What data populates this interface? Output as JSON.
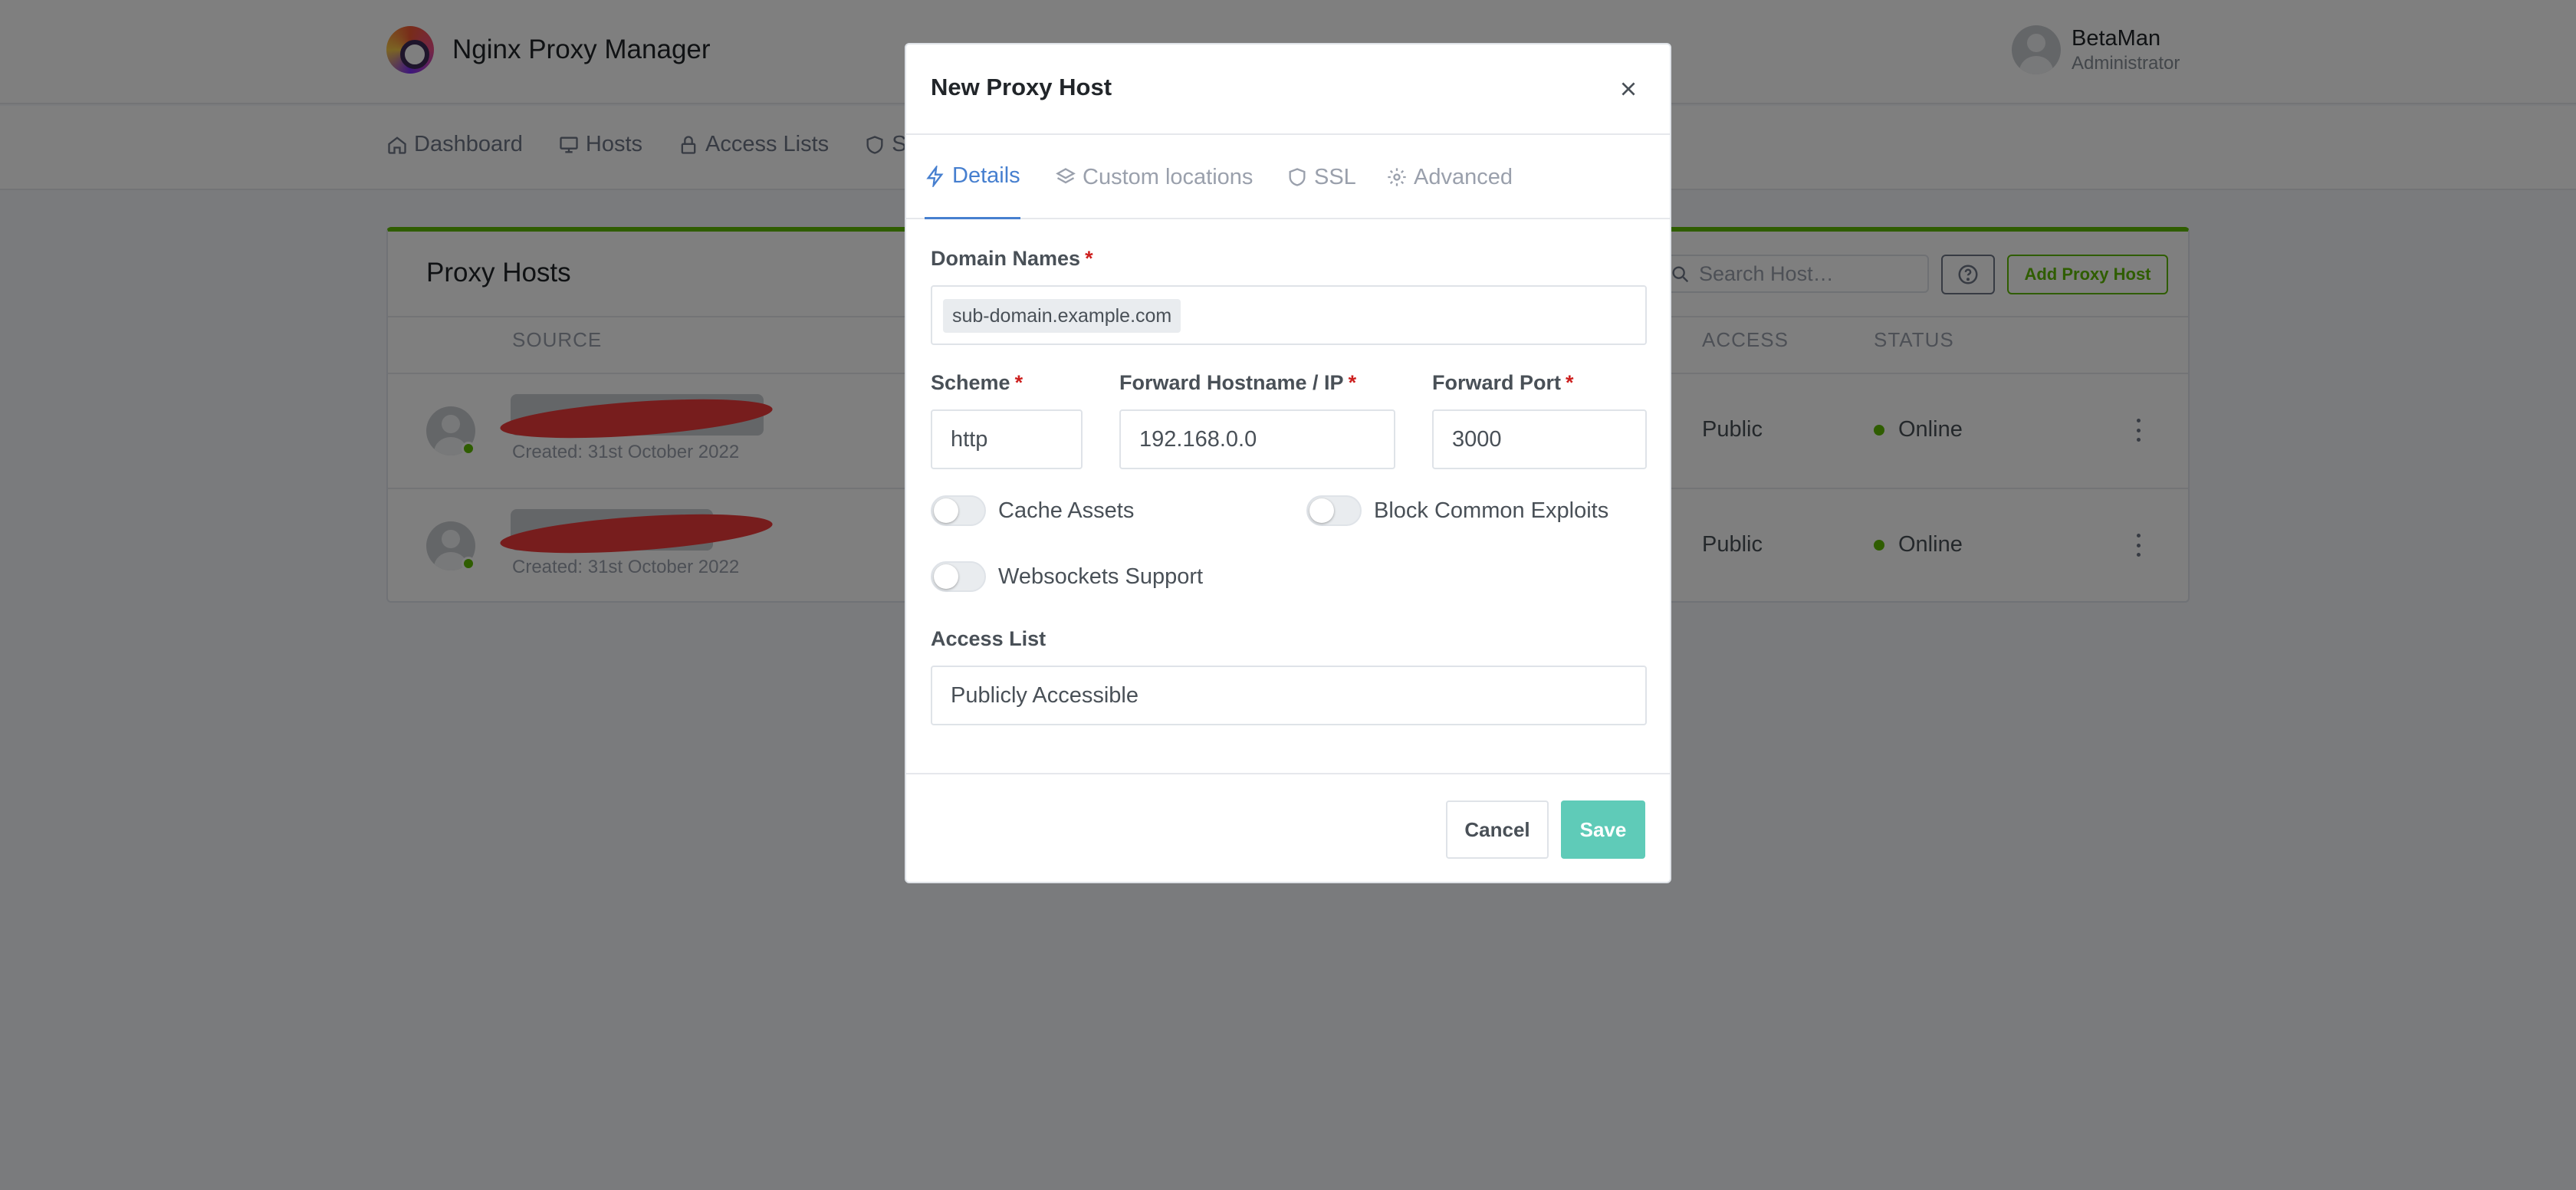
{
  "app": {
    "title": "Nginx Proxy Manager",
    "user": {
      "name": "BetaMan",
      "role": "Administrator"
    }
  },
  "nav": {
    "items": [
      {
        "label": "Dashboard",
        "icon": "home-icon"
      },
      {
        "label": "Hosts",
        "icon": "monitor-icon"
      },
      {
        "label": "Access Lists",
        "icon": "lock-icon"
      },
      {
        "label": "SSL",
        "icon": "shield-icon"
      }
    ]
  },
  "proxy_hosts": {
    "title": "Proxy Hosts",
    "search_placeholder": "Search Host…",
    "add_label": "Add Proxy Host",
    "columns": {
      "source": "SOURCE",
      "access": "ACCESS",
      "status": "STATUS"
    },
    "rows": [
      {
        "created": "Created: 31st October 2022",
        "access": "Public",
        "status": "Online"
      },
      {
        "created": "Created: 31st October 2022",
        "access": "Public",
        "status": "Online"
      }
    ]
  },
  "modal": {
    "title": "New Proxy Host",
    "tabs": [
      {
        "label": "Details",
        "icon": "bolt-icon",
        "active": true
      },
      {
        "label": "Custom locations",
        "icon": "layers-icon",
        "active": false
      },
      {
        "label": "SSL",
        "icon": "shield-icon",
        "active": false
      },
      {
        "label": "Advanced",
        "icon": "gear-icon",
        "active": false
      }
    ],
    "fields": {
      "domain_names": {
        "label": "Domain Names",
        "required": "*",
        "tag": "sub-domain.example.com"
      },
      "scheme": {
        "label": "Scheme",
        "required": "*",
        "value": "http"
      },
      "forward_host": {
        "label": "Forward Hostname / IP",
        "required": "*",
        "value": "192.168.0.0"
      },
      "forward_port": {
        "label": "Forward Port",
        "required": "*",
        "value": "3000"
      },
      "access_list": {
        "label": "Access List",
        "value": "Publicly Accessible"
      }
    },
    "toggles": {
      "cache_assets": {
        "label": "Cache Assets",
        "on": false
      },
      "block_exploits": {
        "label": "Block Common Exploits",
        "on": false
      },
      "websockets": {
        "label": "Websockets Support",
        "on": false
      }
    },
    "buttons": {
      "cancel": "Cancel",
      "save": "Save"
    }
  },
  "colors": {
    "accent": "#467fcf",
    "success": "#5eba00",
    "save_button": "#5fcbb8",
    "required": "#cd201f"
  }
}
